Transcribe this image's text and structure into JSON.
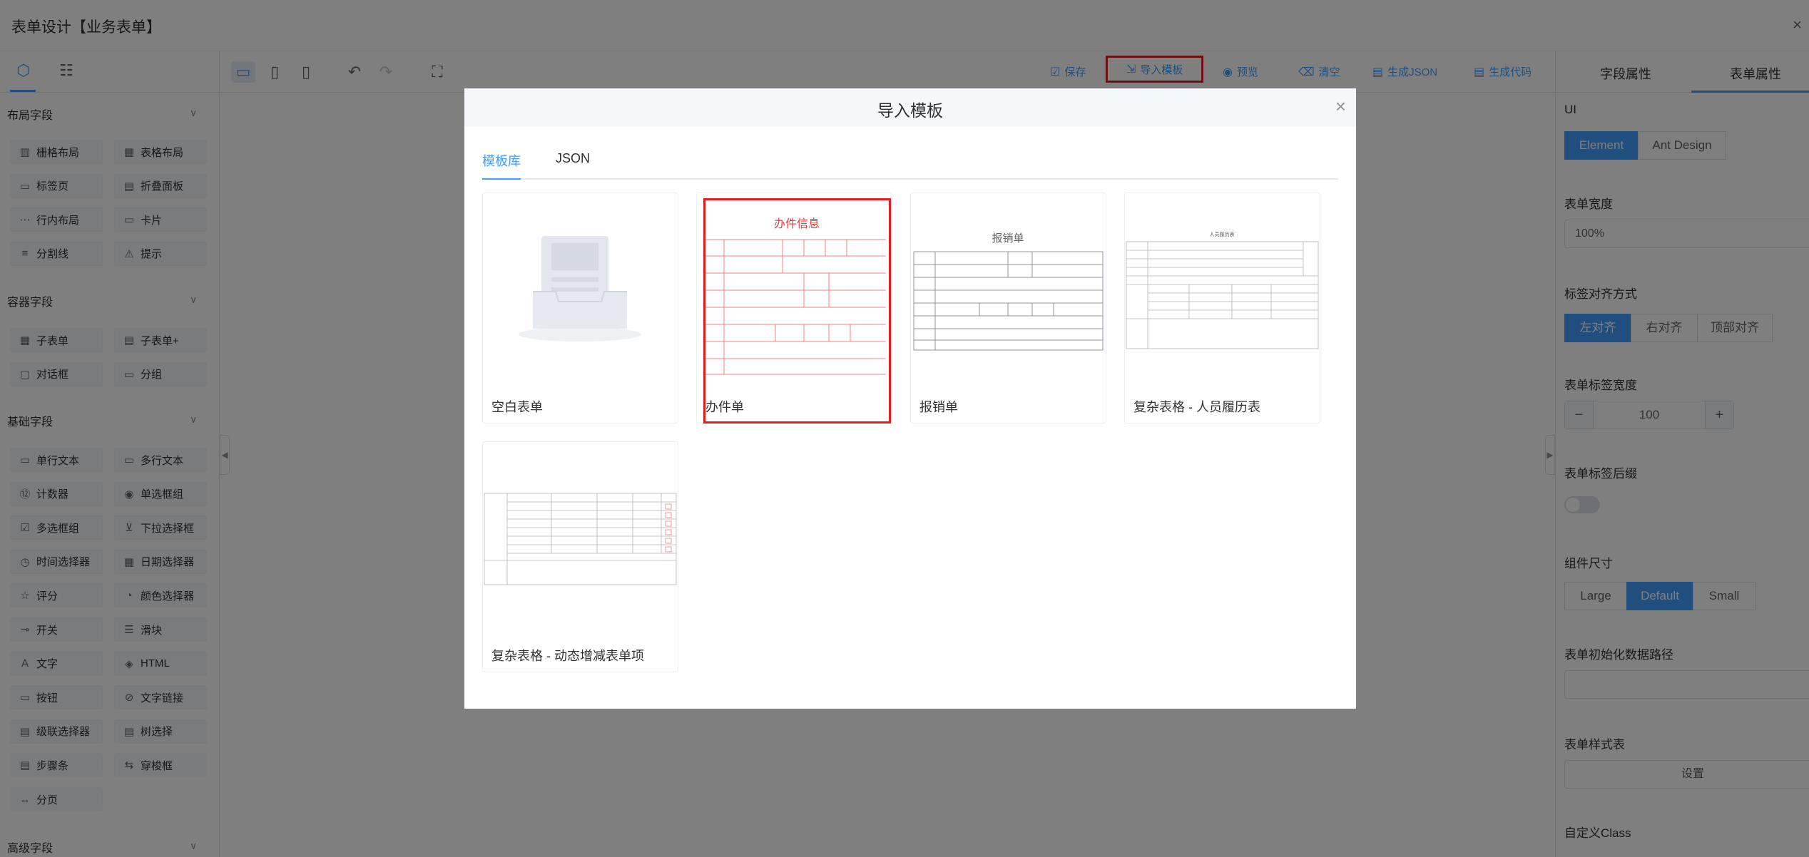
{
  "window": {
    "title": "表单设计【业务表单】",
    "close": "×"
  },
  "left_panel": {
    "tabs": [
      "widgets-icon",
      "tree-icon"
    ],
    "groups": [
      {
        "title": "布局字段",
        "items": [
          {
            "label": "栅格布局",
            "icon": "▥"
          },
          {
            "label": "表格布局",
            "icon": "▦"
          },
          {
            "label": "标签页",
            "icon": "▭"
          },
          {
            "label": "折叠面板",
            "icon": "▤"
          },
          {
            "label": "行内布局",
            "icon": "⋯"
          },
          {
            "label": "卡片",
            "icon": "▭"
          },
          {
            "label": "分割线",
            "icon": "≡"
          },
          {
            "label": "提示",
            "icon": "⚠"
          }
        ]
      },
      {
        "title": "容器字段",
        "items": [
          {
            "label": "子表单",
            "icon": "▦"
          },
          {
            "label": "子表单+",
            "icon": "▤"
          },
          {
            "label": "对话框",
            "icon": "▢"
          },
          {
            "label": "分组",
            "icon": "▭"
          }
        ]
      },
      {
        "title": "基础字段",
        "items": [
          {
            "label": "单行文本",
            "icon": "▭"
          },
          {
            "label": "多行文本",
            "icon": "▭"
          },
          {
            "label": "计数器",
            "icon": "⑫"
          },
          {
            "label": "单选框组",
            "icon": "◉"
          },
          {
            "label": "多选框组",
            "icon": "☑"
          },
          {
            "label": "下拉选择框",
            "icon": "⊻"
          },
          {
            "label": "时间选择器",
            "icon": "◷"
          },
          {
            "label": "日期选择器",
            "icon": "▦"
          },
          {
            "label": "评分",
            "icon": "☆"
          },
          {
            "label": "颜色选择器",
            "icon": "◔"
          },
          {
            "label": "开关",
            "icon": "⊸"
          },
          {
            "label": "滑块",
            "icon": "☰"
          },
          {
            "label": "文字",
            "icon": "A"
          },
          {
            "label": "HTML",
            "icon": "◈"
          },
          {
            "label": "按钮",
            "icon": "▭"
          },
          {
            "label": "文字链接",
            "icon": "⊘"
          },
          {
            "label": "级联选择器",
            "icon": "▤"
          },
          {
            "label": "树选择",
            "icon": "▤"
          },
          {
            "label": "步骤条",
            "icon": "▤"
          },
          {
            "label": "穿梭框",
            "icon": "⇆"
          },
          {
            "label": "分页",
            "icon": "↔"
          }
        ]
      },
      {
        "title": "高级字段",
        "items": []
      }
    ]
  },
  "toolbar": {
    "device_icons": [
      "desktop-icon",
      "tablet-icon",
      "mobile-icon"
    ],
    "actions": [
      {
        "label": "保存",
        "icon": "☑"
      },
      {
        "label": "导入模板",
        "icon": "⇲"
      },
      {
        "label": "预览",
        "icon": "◉"
      },
      {
        "label": "清空",
        "icon": "⌫"
      },
      {
        "label": "生成JSON",
        "icon": "▤"
      },
      {
        "label": "生成代码",
        "icon": "▤"
      }
    ]
  },
  "right_panel": {
    "tabs": [
      "字段属性",
      "表单属性"
    ],
    "ui_label": "UI",
    "ui_options": [
      "Element",
      "Ant Design"
    ],
    "width_label": "表单宽度",
    "width_value": "100%",
    "align_label": "标签对齐方式",
    "align_options": [
      "左对齐",
      "右对齐",
      "顶部对齐"
    ],
    "label_width_label": "表单标签宽度",
    "label_width_value": "100",
    "suffix_label": "表单标签后缀",
    "size_label": "组件尺寸",
    "size_options": [
      "Large",
      "Default",
      "Small"
    ],
    "init_path_label": "表单初始化数据路径",
    "style_label": "表单样式表",
    "style_button": "设置",
    "class_label": "自定义Class"
  },
  "dialog": {
    "title": "导入模板",
    "tabs": [
      "模板库",
      "JSON"
    ],
    "templates": [
      {
        "name": "空白表单",
        "thumb_title": ""
      },
      {
        "name": "办件单",
        "thumb_title": "办件信息"
      },
      {
        "name": "报销单",
        "thumb_title": "报销单"
      },
      {
        "name": "复杂表格 - 人员履历表",
        "thumb_title": "人员履历表"
      },
      {
        "name": "复杂表格 - 动态增减表单项",
        "thumb_title": ""
      }
    ]
  },
  "colors": {
    "accent": "#409eff",
    "highlight": "#e02020",
    "overlay": "rgba(0,0,0,0.5)"
  }
}
